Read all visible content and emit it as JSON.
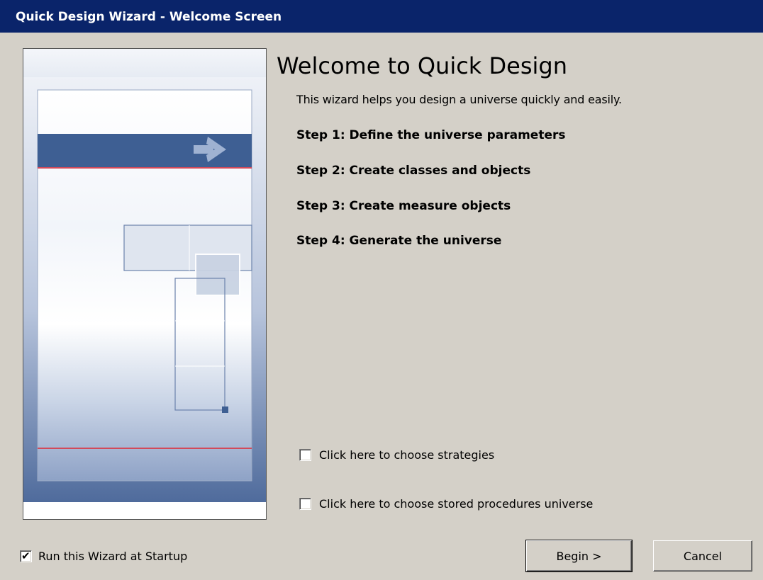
{
  "window": {
    "title": "Quick Design Wizard - Welcome Screen"
  },
  "main": {
    "heading": "Welcome to Quick Design",
    "intro": "This wizard helps you design a universe quickly and easily.",
    "steps": [
      "Step 1: Define the universe parameters",
      "Step 2: Create classes and objects",
      "Step 3: Create measure objects",
      "Step 4: Generate the universe"
    ],
    "options": [
      {
        "label": "Click here to choose strategies",
        "checked": false
      },
      {
        "label": "Click here to choose stored procedures universe",
        "checked": false
      }
    ]
  },
  "footer": {
    "startup_label": "Run this Wizard at Startup",
    "startup_checked": true,
    "begin_label": "Begin >",
    "cancel_label": "Cancel"
  },
  "colors": {
    "titlebar": "#0a246a",
    "dialog": "#d4d0c8",
    "illustration_band": "#3e5f93",
    "illustration_accent": "#d24a5a"
  },
  "icons": {
    "checkmark": "check-icon",
    "arrow": "arrow-right-icon"
  }
}
